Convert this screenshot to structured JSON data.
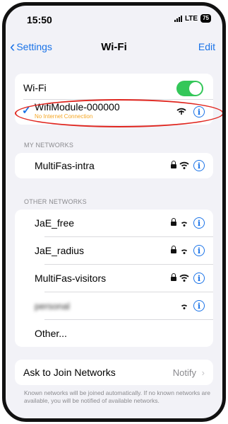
{
  "status_bar": {
    "time": "15:50",
    "carrier": "LTE",
    "battery": "75"
  },
  "nav": {
    "back_label": "Settings",
    "title": "Wi-Fi",
    "edit_label": "Edit"
  },
  "wifi_toggle": {
    "label": "Wi-Fi",
    "on": true
  },
  "connected_network": {
    "name": "WifiModule-000000",
    "status": "No Internet Connection"
  },
  "my_networks": {
    "header": "MY NETWORKS",
    "items": [
      {
        "name": "MultiFas-intra",
        "locked": true
      }
    ]
  },
  "other_networks": {
    "header": "OTHER NETWORKS",
    "items": [
      {
        "name": "JaE_free",
        "locked": true
      },
      {
        "name": "JaE_radius",
        "locked": true
      },
      {
        "name": "MultiFas-visitors",
        "locked": true
      },
      {
        "name": "personal",
        "locked": false
      }
    ],
    "other_label": "Other..."
  },
  "ask_to_join": {
    "label": "Ask to Join Networks",
    "value": "Notify",
    "footnote": "Known networks will be joined automatically. If no known networks are available, you will be notified of available networks."
  },
  "colors": {
    "accent": "#1a73e8",
    "toggle_on": "#34c759",
    "warning": "#f5a623",
    "highlight": "#e0261f"
  }
}
